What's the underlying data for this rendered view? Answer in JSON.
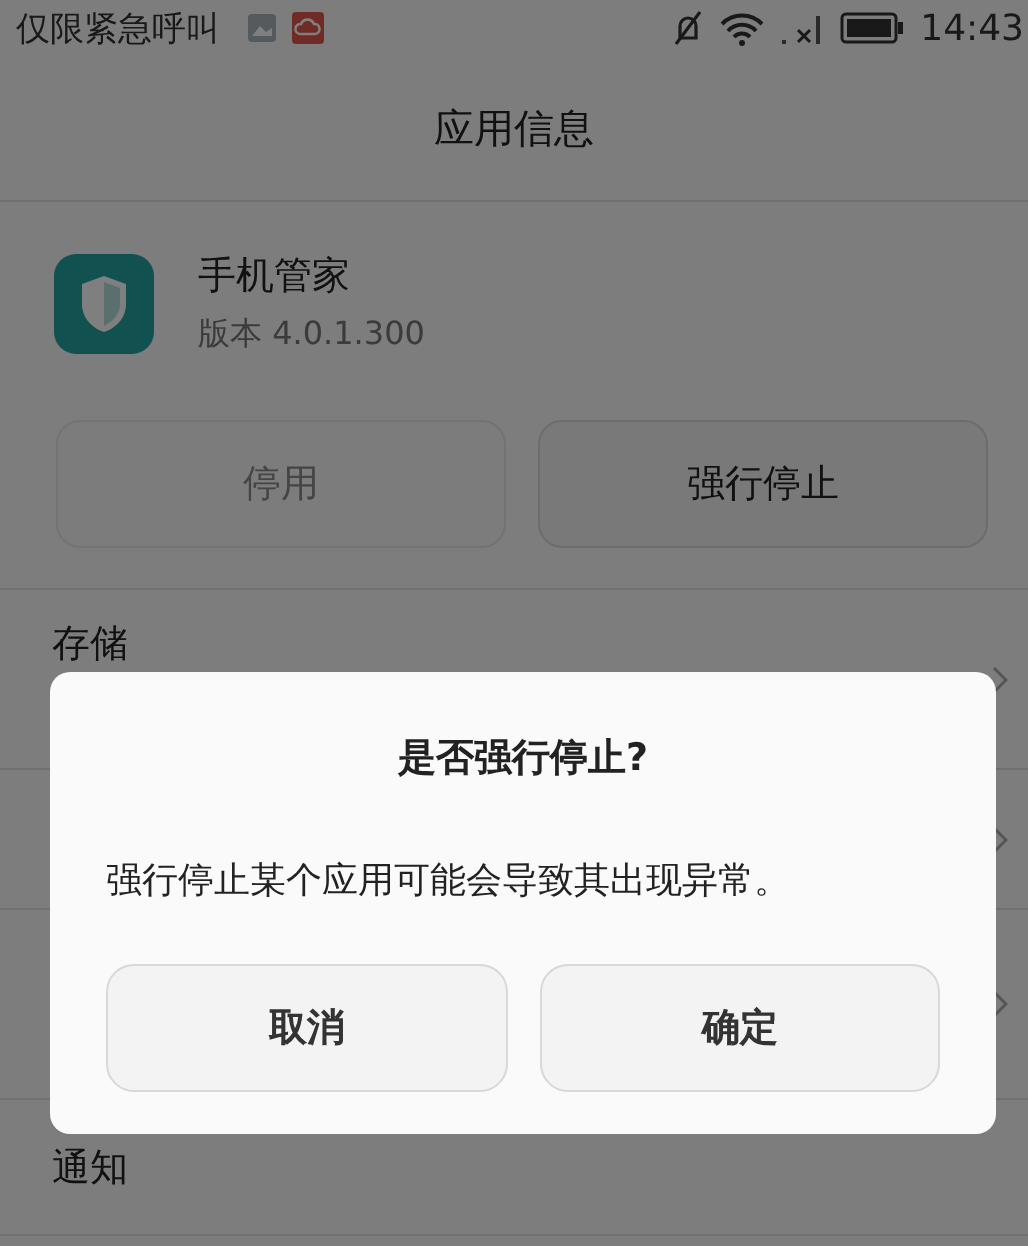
{
  "status_bar": {
    "carrier": "仅限紧急呼叫",
    "time": "14:43"
  },
  "header": {
    "title": "应用信息"
  },
  "app": {
    "name": "手机管家",
    "version": "版本 4.0.1.300"
  },
  "actions": [
    {
      "label": "停用",
      "disabled": true
    },
    {
      "label": "强行停止",
      "disabled": false
    }
  ],
  "rows": [
    {
      "title": "存储",
      "chevron": true
    },
    {
      "chevron": true
    },
    {
      "chevron": true
    },
    {
      "title": "通知",
      "chevron": false
    }
  ],
  "dialog": {
    "title": "是否强行停止?",
    "message": "强行停止某个应用可能会导致其出现异常。",
    "buttons": [
      "取消",
      "确定"
    ]
  }
}
